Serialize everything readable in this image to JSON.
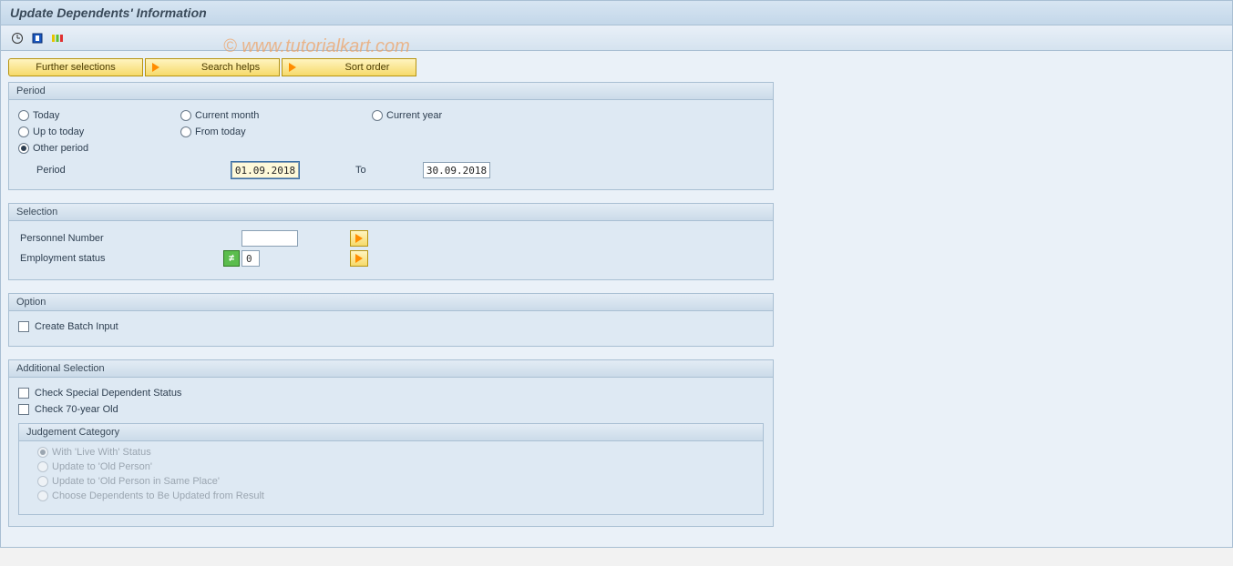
{
  "title": "Update Dependents' Information",
  "watermark": "© www.tutorialkart.com",
  "topButtons": {
    "further": "Further selections",
    "search": "Search helps",
    "sort": "Sort order"
  },
  "period": {
    "header": "Period",
    "today": "Today",
    "currentMonth": "Current month",
    "currentYear": "Current year",
    "upToToday": "Up to today",
    "fromToday": "From today",
    "otherPeriod": "Other period",
    "periodLabel": "Period",
    "toLabel": "To",
    "from": "01.09.2018",
    "to": "30.09.2018"
  },
  "selection": {
    "header": "Selection",
    "personnel": "Personnel Number",
    "personnelValue": "",
    "employment": "Employment status",
    "employmentValue": "0"
  },
  "option": {
    "header": "Option",
    "batch": "Create Batch Input"
  },
  "additional": {
    "header": "Additional Selection",
    "special": "Check Special Dependent Status",
    "seventy": "Check 70-year Old",
    "judgementHeader": "Judgement Category",
    "j1": "With 'Live With' Status",
    "j2": "Update to 'Old Person'",
    "j3": "Update to 'Old Person in Same Place'",
    "j4": "Choose Dependents to Be Updated from Result"
  }
}
